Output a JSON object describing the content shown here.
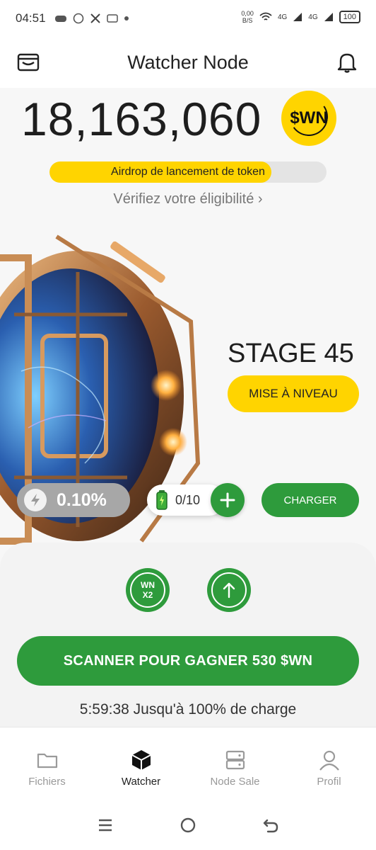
{
  "status_bar": {
    "time": "04:51",
    "speed_value": "0,00",
    "speed_unit": "B/S",
    "network_1": "4G",
    "network_2": "4G",
    "battery": "100",
    "icons": [
      "game-controller-icon",
      "whatsapp-icon",
      "x-icon",
      "message-icon",
      "dot-icon",
      "wifi-icon",
      "signal-icon"
    ]
  },
  "header": {
    "title": "Watcher Node",
    "left_icon": "wallet-icon",
    "right_icon": "bell-icon"
  },
  "balance": {
    "value": "18,163,060",
    "token": "$WN"
  },
  "airdrop": {
    "label": "Airdrop de lancement de token",
    "progress": 0.8
  },
  "eligibility": {
    "label": "Vérifiez votre éligibilité ›"
  },
  "stage": {
    "label": "STAGE 45",
    "upgrade_label": "MISE À NIVEAU"
  },
  "rate": {
    "value": "0.10%"
  },
  "batteries": {
    "count": "0/10"
  },
  "charge": {
    "label": "CHARGER"
  },
  "boosts": {
    "multiplier_top": "WN",
    "multiplier_bottom": "X2"
  },
  "scan": {
    "label": "SCANNER POUR GAGNER 530 $WN"
  },
  "timer": {
    "label": "5:59:38 Jusqu'à 100% de charge"
  },
  "tabs": [
    {
      "label": "Fichiers",
      "icon": "folder-icon",
      "active": false
    },
    {
      "label": "Watcher",
      "icon": "cube-icon",
      "active": true
    },
    {
      "label": "Node Sale",
      "icon": "server-icon",
      "active": false
    },
    {
      "label": "Profil",
      "icon": "user-icon",
      "active": false
    }
  ],
  "colors": {
    "accent_green": "#2e9b3c",
    "accent_yellow": "#ffd400"
  }
}
